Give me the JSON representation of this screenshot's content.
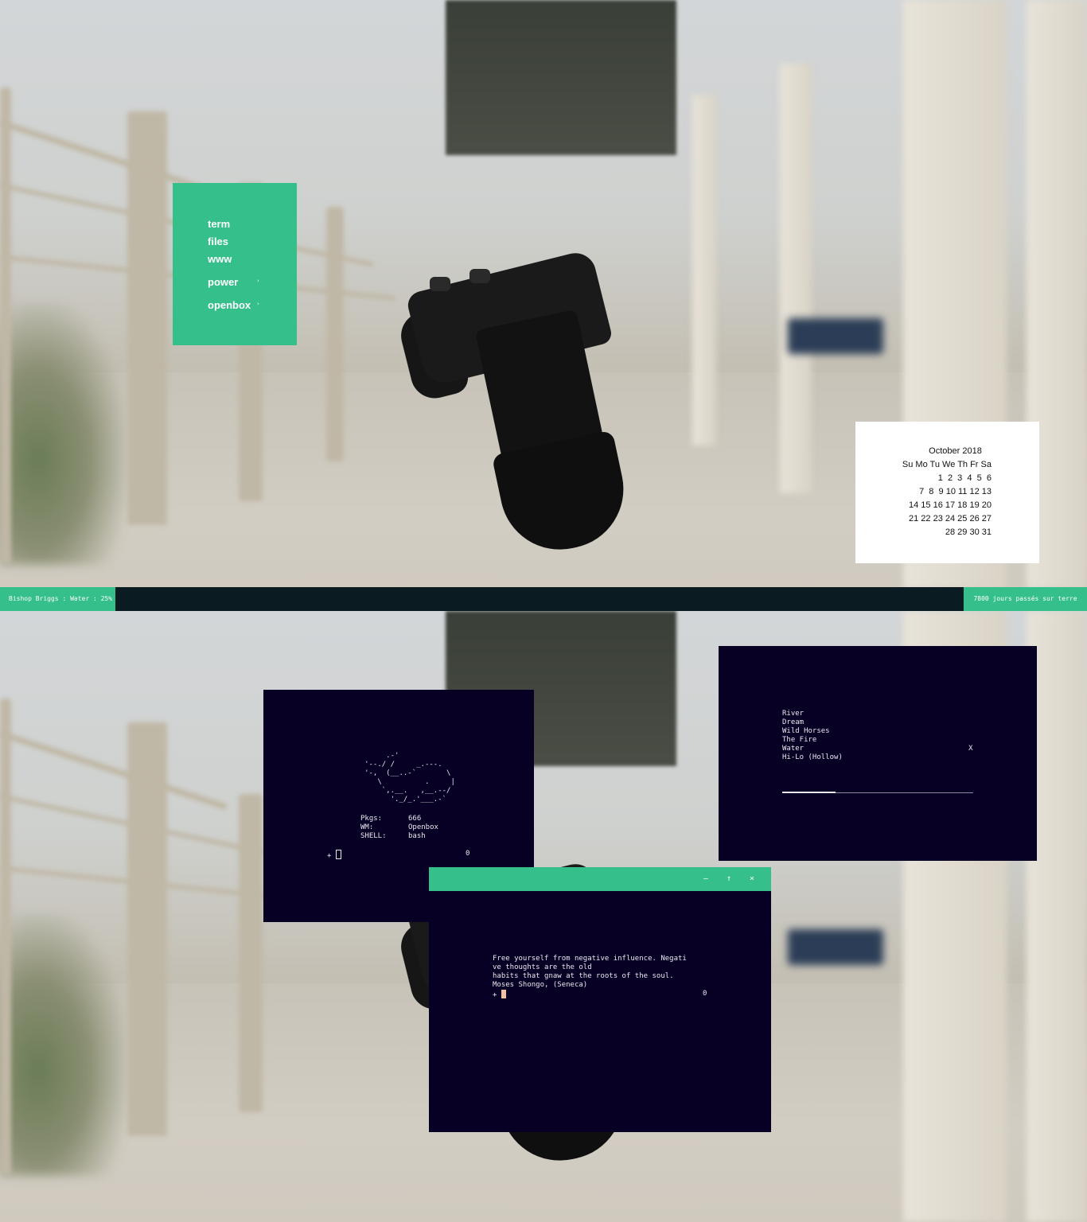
{
  "menu": {
    "items": [
      {
        "label": "term"
      },
      {
        "label": "files"
      },
      {
        "label": "www"
      },
      {
        "label": "power",
        "submenu": true
      },
      {
        "label": "openbox",
        "submenu": true
      }
    ],
    "arrow": "›"
  },
  "calendar": {
    "title": "October 2018",
    "header": "Su Mo Tu We Th Fr Sa",
    "rows": [
      "1  2  3  4  5  6",
      "7  8  9 10 11 12 13",
      "14 15 16 17 18 19 20",
      "21 22 23 24 25 26 27",
      "28 29 30 31"
    ]
  },
  "panel": {
    "left_text": "Bishop Briggs : Water : 25%",
    "right_text": "7800 jours passés sur terre"
  },
  "fetch_terminal": {
    "ascii_art": "          .-'\n     '--./ /     _.---.\n     '-,  (__..-`       \\\n        \\          .     |\n         `,.__.   ,__.--/\n           '._/_.'___.-`",
    "info": [
      {
        "key": "Pkgs:",
        "value": "666"
      },
      {
        "key": "WM:",
        "value": "Openbox"
      },
      {
        "key": "SHELL:",
        "value": "bash"
      }
    ],
    "prompt": "+",
    "status": "0"
  },
  "music_terminal": {
    "tracks": [
      "River",
      "Dream",
      "Wild Horses",
      "The Fire",
      "Water",
      "Hi-Lo (Hollow)"
    ],
    "current_marker": "X",
    "current_index": 4,
    "progress": 0.28
  },
  "quote_terminal": {
    "titlebar": {
      "minimize": "–",
      "maximize": "↑",
      "close": "×"
    },
    "lines": [
      "Free yourself from negative influence. Negati",
      "ve thoughts are the old",
      "habits that gnaw at the roots of the soul.",
      "Moses Shongo, (Seneca)"
    ],
    "prompt": "+",
    "status": "0"
  },
  "colors": {
    "accent": "#35bf8a",
    "terminal_bg": "#070024",
    "panel_bg": "#0a1c22"
  }
}
